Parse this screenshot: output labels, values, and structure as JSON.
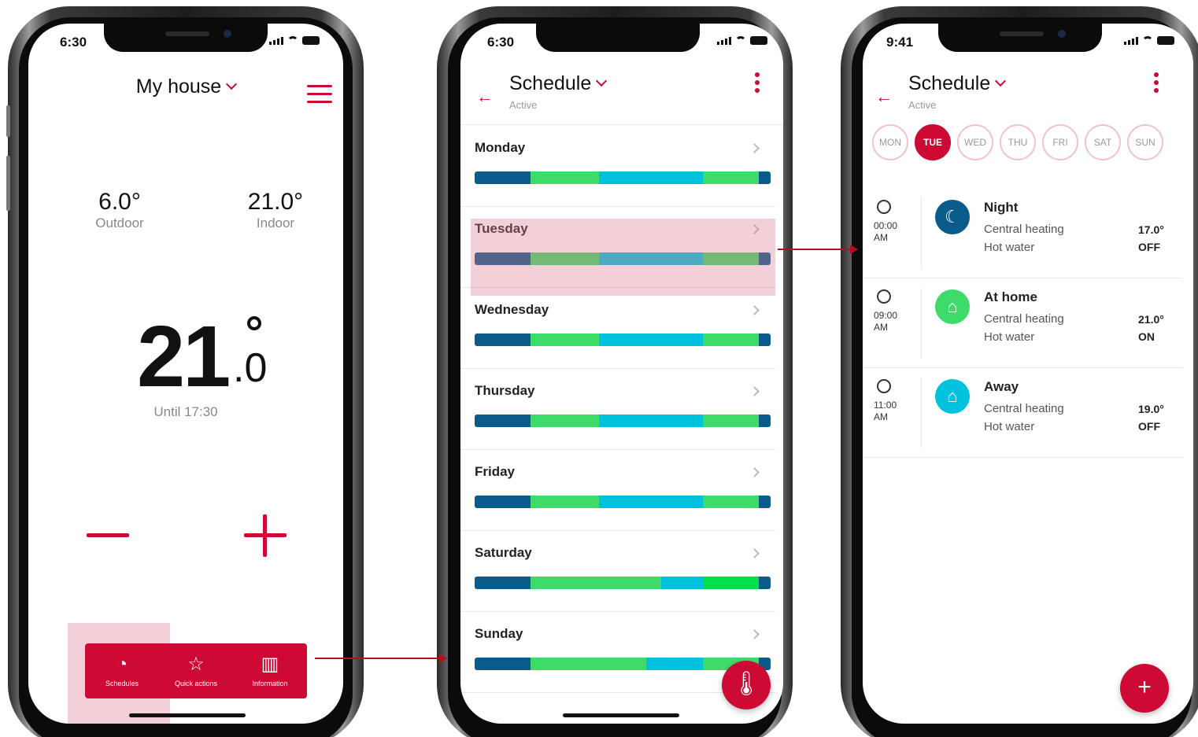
{
  "colors": {
    "accent": "#cc0a33",
    "night": "#0a5a8c",
    "home": "#3ddc6a",
    "away": "#00c2de",
    "eco": "#00e04c"
  },
  "screen1": {
    "status_time": "6:30",
    "title": "My house",
    "outdoor_value": "6.0°",
    "outdoor_label": "Outdoor",
    "indoor_value": "21.0°",
    "indoor_label": "Indoor",
    "setpoint_int": "21",
    "setpoint_dec": ".0",
    "until": "Until 17:30",
    "nav": [
      {
        "label": "Schedules",
        "icon": "schedule-icon"
      },
      {
        "label": "Quick actions",
        "icon": "quick-actions-icon"
      },
      {
        "label": "Information",
        "icon": "chart-icon"
      }
    ]
  },
  "screen2": {
    "status_time": "6:30",
    "title": "Schedule",
    "subtitle": "Active",
    "days": [
      {
        "name": "Monday",
        "segments": [
          [
            "night",
            19
          ],
          [
            "home",
            23
          ],
          [
            "away",
            35
          ],
          [
            "home",
            19
          ],
          [
            "night",
            4
          ]
        ]
      },
      {
        "name": "Tuesday",
        "segments": [
          [
            "night",
            19
          ],
          [
            "home",
            23
          ],
          [
            "away",
            35
          ],
          [
            "home",
            19
          ],
          [
            "night",
            4
          ]
        ]
      },
      {
        "name": "Wednesday",
        "segments": [
          [
            "night",
            19
          ],
          [
            "home",
            23
          ],
          [
            "away",
            35
          ],
          [
            "home",
            19
          ],
          [
            "night",
            4
          ]
        ]
      },
      {
        "name": "Thursday",
        "segments": [
          [
            "night",
            19
          ],
          [
            "home",
            23
          ],
          [
            "away",
            35
          ],
          [
            "home",
            19
          ],
          [
            "night",
            4
          ]
        ]
      },
      {
        "name": "Friday",
        "segments": [
          [
            "night",
            19
          ],
          [
            "home",
            23
          ],
          [
            "away",
            35
          ],
          [
            "home",
            19
          ],
          [
            "night",
            4
          ]
        ]
      },
      {
        "name": "Saturday",
        "segments": [
          [
            "night",
            19
          ],
          [
            "home",
            44
          ],
          [
            "away",
            14
          ],
          [
            "eco",
            19
          ],
          [
            "night",
            4
          ]
        ]
      },
      {
        "name": "Sunday",
        "segments": [
          [
            "night",
            19
          ],
          [
            "home",
            39
          ],
          [
            "away",
            19
          ],
          [
            "home",
            19
          ],
          [
            "night",
            4
          ]
        ]
      }
    ]
  },
  "screen3": {
    "status_time": "9:41",
    "title": "Schedule",
    "subtitle": "Active",
    "day_pills": [
      "MON",
      "TUE",
      "WED",
      "THU",
      "FRI",
      "SAT",
      "SUN"
    ],
    "selected_day": "TUE",
    "entries": [
      {
        "time": "00:00",
        "ampm": "AM",
        "name": "Night",
        "icon": "moon-icon",
        "heating_label": "Central heating",
        "heating_value": "17.0°",
        "water_label": "Hot water",
        "water_value": "OFF"
      },
      {
        "time": "09:00",
        "ampm": "AM",
        "name": "At home",
        "icon": "home-icon",
        "heating_label": "Central heating",
        "heating_value": "21.0°",
        "water_label": "Hot water",
        "water_value": "ON"
      },
      {
        "time": "11:00",
        "ampm": "AM",
        "name": "Away",
        "icon": "away-icon",
        "heating_label": "Central heating",
        "heating_value": "19.0°",
        "water_label": "Hot water",
        "water_value": "OFF"
      }
    ]
  }
}
